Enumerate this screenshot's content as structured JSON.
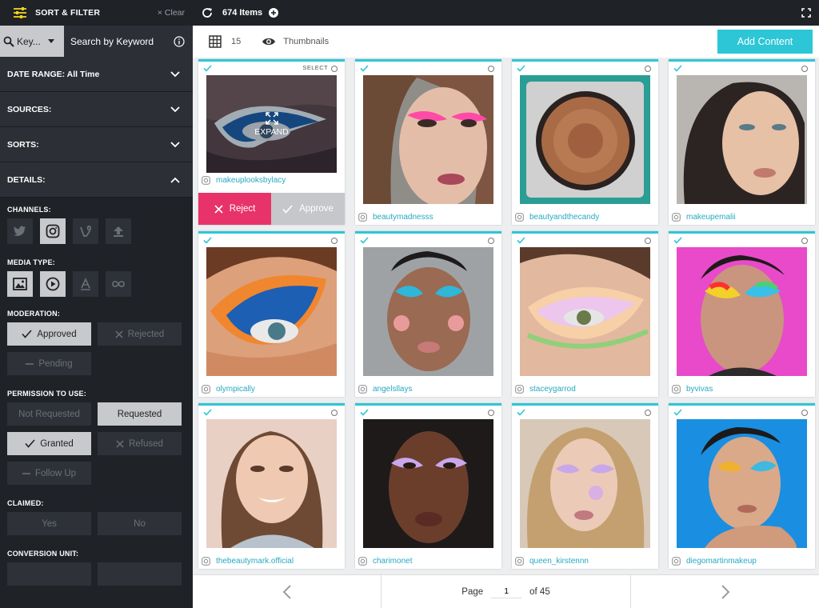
{
  "sidebar": {
    "title": "SORT & FILTER",
    "clear_label": "Clear",
    "keyword_select": "Key...",
    "keyword_placeholder": "Search by Keyword",
    "sections": {
      "date_range": "DATE RANGE: All Time",
      "sources": "SOURCES:",
      "sorts": "SORTS:",
      "details": "DETAILS:"
    },
    "channels_label": "CHANNELS:",
    "media_type_label": "MEDIA TYPE:",
    "moderation": {
      "label": "MODERATION:",
      "approved": "Approved",
      "rejected": "Rejected",
      "pending": "Pending"
    },
    "permission": {
      "label": "PERMISSION TO USE:",
      "not_requested": "Not Requested",
      "requested": "Requested",
      "granted": "Granted",
      "refused": "Refused",
      "follow_up": "Follow Up"
    },
    "claimed": {
      "label": "CLAIMED:",
      "yes": "Yes",
      "no": "No"
    },
    "conversion_label": "CONVERSION UNIT:"
  },
  "topbar": {
    "count": "674 Items"
  },
  "toolbar": {
    "per_row": "15",
    "view_label": "Thumbnails",
    "add_label": "Add Content"
  },
  "cards": [
    {
      "username": "makeuplooksbylacy",
      "select_label": "SELECT",
      "expand_label": "EXPAND",
      "reject_label": "Reject",
      "approve_label": "Approve"
    },
    {
      "username": "beautymadnesss"
    },
    {
      "username": "beautyandthecandy"
    },
    {
      "username": "makeupemalii"
    },
    {
      "username": "olympically"
    },
    {
      "username": "angelsllays"
    },
    {
      "username": "staceygarrod"
    },
    {
      "username": "byvivas"
    },
    {
      "username": "thebeautymark.official"
    },
    {
      "username": "charimonet"
    },
    {
      "username": "queen_kirstennn"
    },
    {
      "username": "diegomartinmakeup"
    }
  ],
  "pager": {
    "page_label": "Page",
    "current": "1",
    "of_label": "of 45"
  },
  "colors": {
    "accent": "#2cc6d6",
    "reject": "#e8336a",
    "sidebar_bg": "#1f2227",
    "filter_icon": "#f5d316"
  }
}
